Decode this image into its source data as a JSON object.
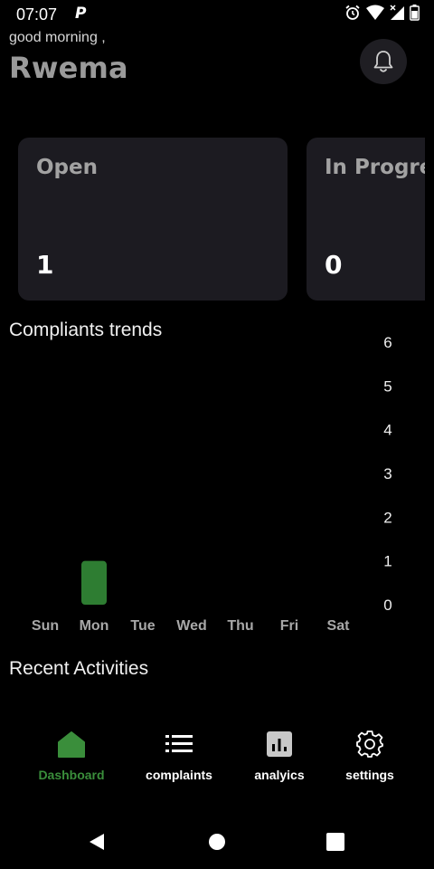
{
  "status_bar": {
    "time": "07:07",
    "app_badge": "P"
  },
  "header": {
    "greeting": "good morning ,",
    "user_name": "Rwema"
  },
  "cards": [
    {
      "title": "Open",
      "value": "1"
    },
    {
      "title": "In Progress",
      "value": "0"
    }
  ],
  "trends": {
    "title": "Compliants trends"
  },
  "chart_data": {
    "type": "bar",
    "categories": [
      "Sun",
      "Mon",
      "Tue",
      "Wed",
      "Thu",
      "Fri",
      "Sat"
    ],
    "values": [
      0,
      1,
      0,
      0,
      0,
      0,
      0
    ],
    "y_ticks": [
      0,
      1,
      2,
      3,
      4,
      5,
      6
    ],
    "ylim": [
      0,
      6
    ],
    "y_axis_side": "right",
    "grid": false,
    "bar_color": "#2e7d32"
  },
  "recent": {
    "title": "Recent Activities"
  },
  "nav": {
    "items": [
      {
        "label": "Dashboard",
        "icon": "home-icon",
        "active": true
      },
      {
        "label": "complaints",
        "icon": "list-icon",
        "active": false
      },
      {
        "label": "analyics",
        "icon": "analytics-icon",
        "active": false
      },
      {
        "label": "settings",
        "icon": "gear-icon",
        "active": false
      }
    ],
    "active_color": "#3a8e3b"
  }
}
